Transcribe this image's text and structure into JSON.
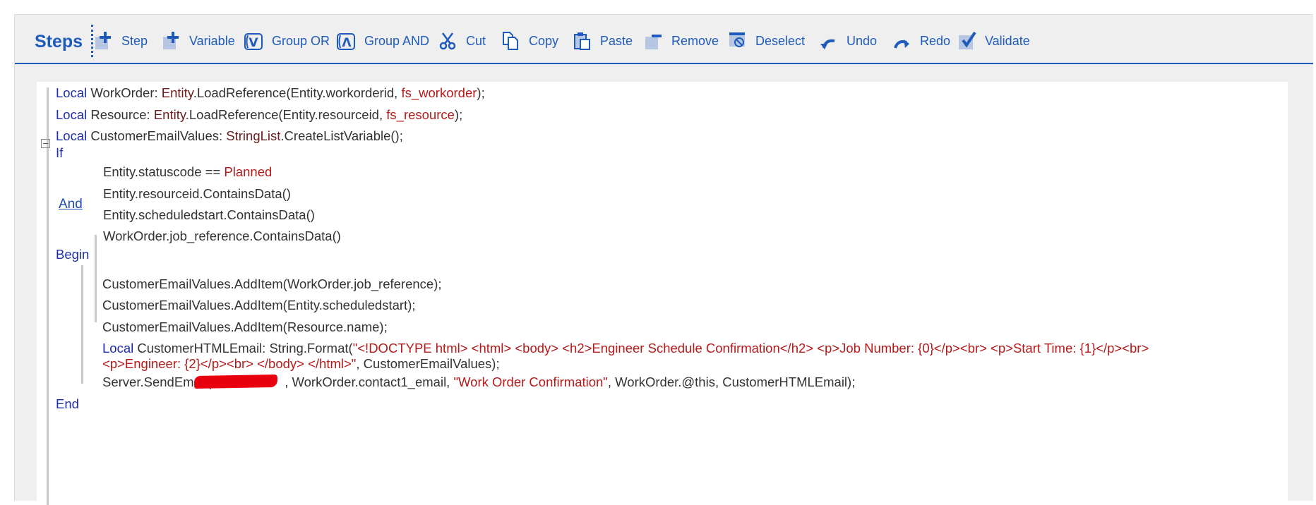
{
  "toolbar": {
    "title": "Steps",
    "buttons": [
      {
        "label": "Step",
        "icon": "plus-icon"
      },
      {
        "label": "Variable",
        "icon": "plus-icon"
      },
      {
        "label": "Group OR",
        "icon": "group-or-icon"
      },
      {
        "label": "Group AND",
        "icon": "group-and-icon"
      },
      {
        "label": "Cut",
        "icon": "scissors-icon"
      },
      {
        "label": "Copy",
        "icon": "copy-icon"
      },
      {
        "label": "Paste",
        "icon": "clipboard-icon"
      },
      {
        "label": "Remove",
        "icon": "minus-icon"
      },
      {
        "label": "Deselect",
        "icon": "deselect-icon"
      },
      {
        "label": "Undo",
        "icon": "undo-arrow-icon"
      },
      {
        "label": "Redo",
        "icon": "redo-arrow-icon"
      },
      {
        "label": "Validate",
        "icon": "checkmark-icon"
      }
    ]
  },
  "colors": {
    "accent": "#1f5bbd",
    "keyword": "#1f2ea8",
    "string": "#b51a1a",
    "redaction": "#e8000f"
  },
  "code": {
    "local": "Local",
    "line1": {
      "name": " WorkOrder: ",
      "type": "Entity",
      "call": ".LoadReference(Entity.workorderid, ",
      "arg": "fs_workorder",
      "end": ");"
    },
    "line2": {
      "name": " Resource: ",
      "type": "Entity",
      "call": ".LoadReference(Entity.resourceid, ",
      "arg": "fs_resource",
      "end": ");"
    },
    "line3": {
      "name": " CustomerEmailValues: ",
      "type": "StringList",
      "call": ".CreateListVariable();"
    },
    "if": "If",
    "and": "And",
    "conditions": {
      "c1_pre": "Entity.statuscode == ",
      "c1_val": "Planned",
      "c2": "Entity.resourceid.ContainsData()",
      "c3": "Entity.scheduledstart.ContainsData()",
      "c4": "WorkOrder.job_reference.ContainsData()"
    },
    "begin": "Begin",
    "body": {
      "b1": "CustomerEmailValues.AddItem(WorkOrder.job_reference);",
      "b2": "CustomerEmailValues.AddItem(Entity.scheduledstart);",
      "b3": "CustomerEmailValues.AddItem(Resource.name);",
      "b4_local": "Local",
      "b4_pre": " CustomerHTMLEmail: String.Format(",
      "b4_str1": "\"<!DOCTYPE html> <html> <body> <h2>Engineer Schedule Confirmation</h2> <p>Job Number: {0}</p><br> <p>Start Time: {1}</p><br>",
      "b4_str2": "<p>Engineer: {2}</p><br> </body> </html>\"",
      "b4_post": ", CustomerEmailValues);",
      "b5_pre": "Server.SendEmail(",
      "b5_mid": ", WorkOrder.contact1_email, ",
      "b5_str": "\"Work Order Confirmation\"",
      "b5_post": ", WorkOrder.@this, CustomerHTMLEmail);"
    },
    "end": "End"
  }
}
